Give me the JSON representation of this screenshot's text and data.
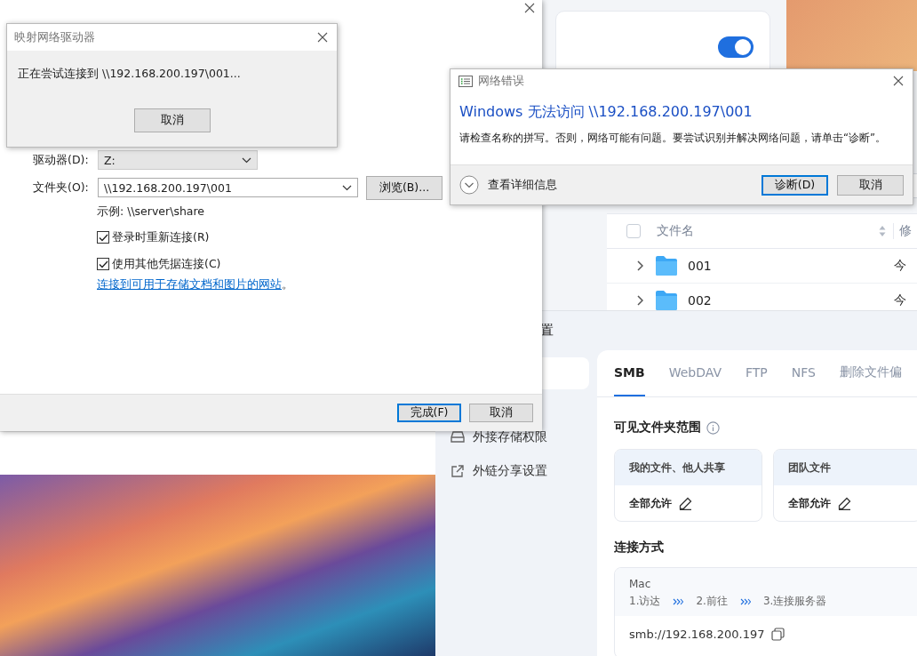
{
  "file_manager": {
    "toggle": {
      "on": true
    },
    "select_all": {
      "checked": false
    },
    "columns": [
      "文件名",
      "修"
    ],
    "rows": [
      {
        "name": "001",
        "modified": "今"
      },
      {
        "name": "002",
        "modified": "今"
      }
    ]
  },
  "settings": {
    "header": "置",
    "sidebar": [
      {
        "label": "外接存储权限",
        "kind": "drive",
        "selected": false
      },
      {
        "label": "外链分享设置",
        "kind": "share",
        "selected": false
      }
    ],
    "tabs": [
      {
        "label": "SMB",
        "selected": true
      },
      {
        "label": "WebDAV",
        "selected": false
      },
      {
        "label": "FTP",
        "selected": false
      },
      {
        "label": "NFS",
        "selected": false
      },
      {
        "label": "删除文件偏",
        "selected": false
      }
    ],
    "scope_title": "可见文件夹范围",
    "scope_cards": [
      {
        "title": "我的文件、他人共享",
        "value": "全部允许"
      },
      {
        "title": "团队文件",
        "value": "全部允许"
      }
    ],
    "connection_title": "连接方式",
    "platform": "Mac",
    "steps": [
      "1.访达",
      "2.前往",
      "3.连接服务器"
    ],
    "address": "smb://192.168.200.197"
  },
  "map_drive": {
    "drive_label": "驱动器(D):",
    "drive_value": "Z:",
    "folder_label": "文件夹(O):",
    "folder_value": "\\\\192.168.200.197\\001",
    "browse": "浏览(B)...",
    "example": "示例: \\\\server\\share",
    "options": [
      {
        "label": "登录时重新连接(R)",
        "checked": true
      },
      {
        "label": "使用其他凭据连接(C)",
        "checked": true
      }
    ],
    "link": "连接到可用于存储文档和图片的网站",
    "link_suffix": "。",
    "buttons": [
      {
        "label": "完成(F)",
        "default": true
      },
      {
        "label": "取消",
        "default": false
      }
    ]
  },
  "progress_dialog": {
    "title": "映射网络驱动器",
    "message": "正在尝试连接到 \\\\192.168.200.197\\001...",
    "button": "取消"
  },
  "error_dialog": {
    "title": "网络错误",
    "heading": "Windows 无法访问 \\\\192.168.200.197\\001",
    "message": "请检查名称的拼写。否则，网络可能有问题。要尝试识别并解决网络问题，请单击“诊断”。",
    "details": "查看详细信息",
    "buttons": [
      {
        "label": "诊断(D)",
        "default": true
      },
      {
        "label": "取消",
        "default": false
      }
    ]
  }
}
